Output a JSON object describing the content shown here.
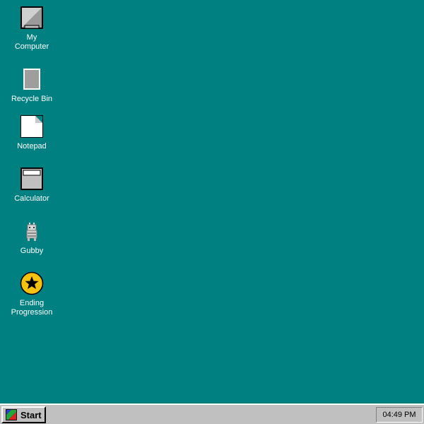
{
  "desktop": {
    "background_color": "#008080",
    "icons": [
      {
        "label": "My\nComputer",
        "icon": "computer-icon"
      },
      {
        "label": "Recycle Bin",
        "icon": "recycle-bin-icon"
      },
      {
        "label": "Notepad",
        "icon": "notepad-icon"
      },
      {
        "label": "Calculator",
        "icon": "calculator-icon"
      },
      {
        "label": "Gubby",
        "icon": "gubby-icon"
      },
      {
        "label": "Ending\nProgression",
        "icon": "star-icon"
      }
    ]
  },
  "taskbar": {
    "start_label": "Start",
    "clock": "04:49 PM",
    "background_color": "#c0c0c0"
  },
  "colors": {
    "star_yellow": "#f4c20d"
  }
}
